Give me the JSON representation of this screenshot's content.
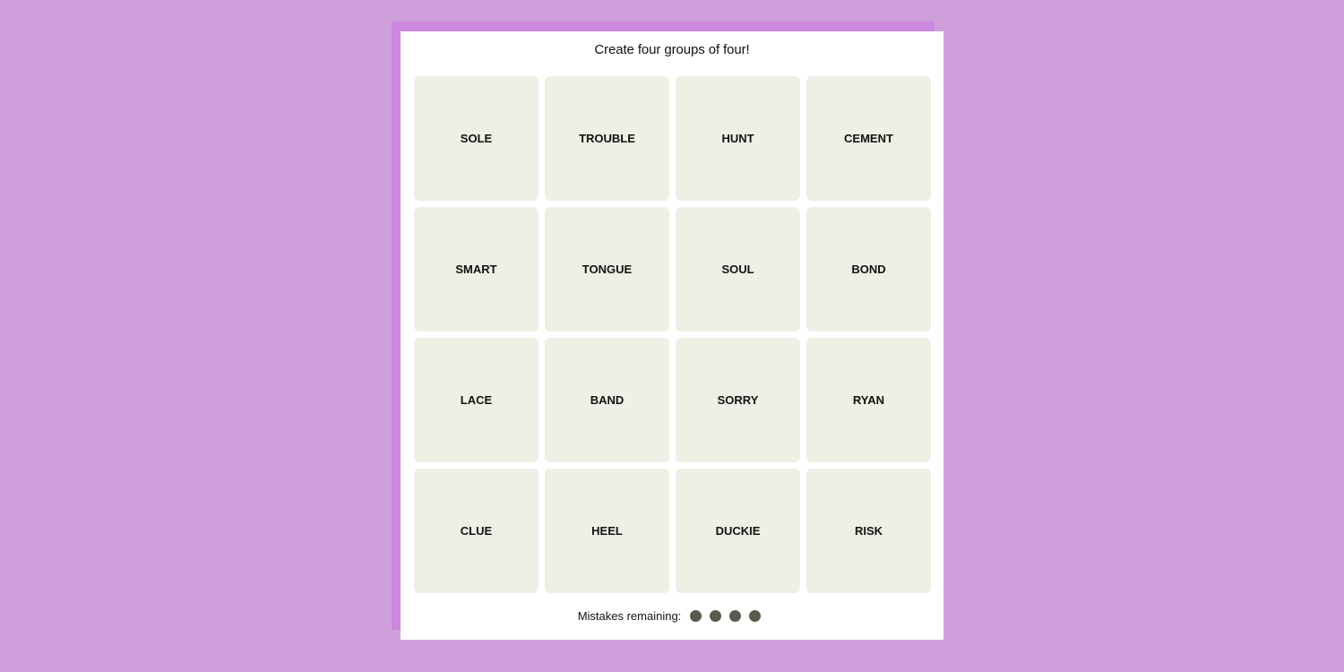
{
  "game": {
    "instruction": "Create four groups of four!",
    "tiles": [
      {
        "word": "SOLE"
      },
      {
        "word": "TROUBLE"
      },
      {
        "word": "HUNT"
      },
      {
        "word": "CEMENT"
      },
      {
        "word": "SMART"
      },
      {
        "word": "TONGUE"
      },
      {
        "word": "SOUL"
      },
      {
        "word": "BOND"
      },
      {
        "word": "LACE"
      },
      {
        "word": "BAND"
      },
      {
        "word": "SORRY"
      },
      {
        "word": "RYAN"
      },
      {
        "word": "CLUE"
      },
      {
        "word": "HEEL"
      },
      {
        "word": "DUCKIE"
      },
      {
        "word": "RISK"
      }
    ],
    "mistakes": {
      "label": "Mistakes remaining:",
      "remaining": 4,
      "total": 4,
      "dot_color": "#5a594e"
    }
  },
  "colors": {
    "background": "#cf9fdc",
    "accent_shadow": "#cd87de",
    "card": "#ffffff",
    "tile": "#efefe6",
    "text": "#121212"
  }
}
